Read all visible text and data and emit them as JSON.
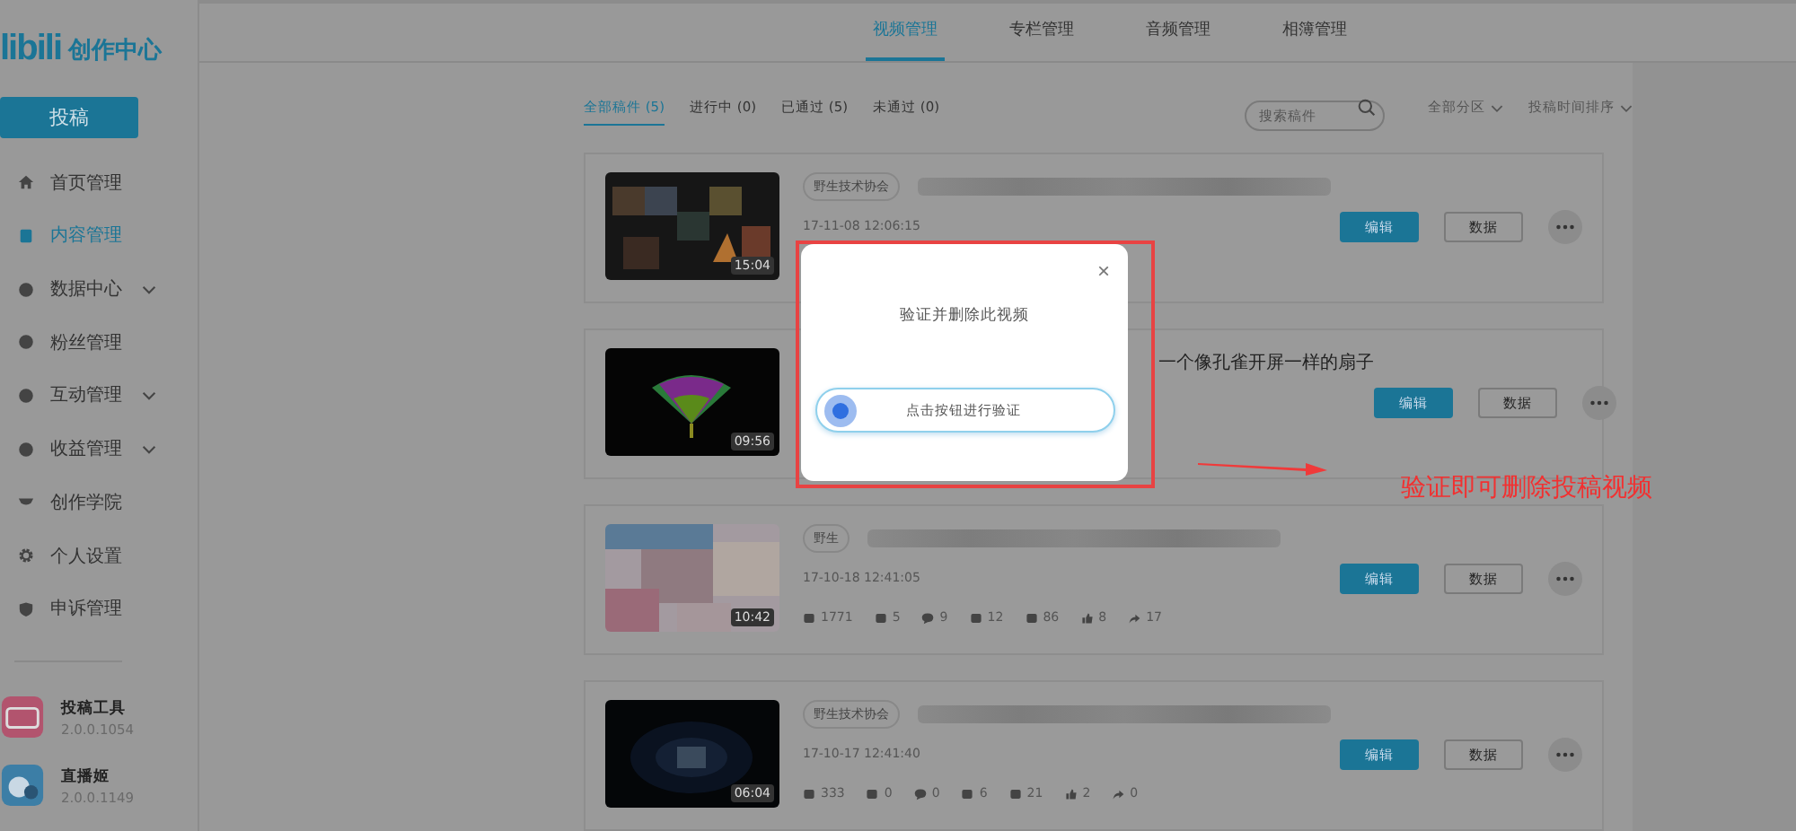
{
  "sidebar": {
    "logo_mark": "libili",
    "logo_text": "创作中心",
    "upload_button": "投稿",
    "items": [
      {
        "label": "首页管理",
        "selected": false,
        "has_submenu": false
      },
      {
        "label": "内容管理",
        "selected": true,
        "has_submenu": false
      },
      {
        "label": "数据中心",
        "selected": false,
        "has_submenu": true
      },
      {
        "label": "粉丝管理",
        "selected": false,
        "has_submenu": false
      },
      {
        "label": "互动管理",
        "selected": false,
        "has_submenu": true
      },
      {
        "label": "收益管理",
        "selected": false,
        "has_submenu": true
      },
      {
        "label": "创作学院",
        "selected": false,
        "has_submenu": false
      },
      {
        "label": "个人设置",
        "selected": false,
        "has_submenu": false
      },
      {
        "label": "申诉管理",
        "selected": false,
        "has_submenu": false
      }
    ],
    "apps": [
      {
        "name": "投稿工具",
        "version": "2.0.0.1054",
        "kind": "upload"
      },
      {
        "name": "直播姬",
        "version": "2.0.0.1149",
        "kind": "live"
      }
    ]
  },
  "top_tabs": [
    {
      "label": "视频管理",
      "selected": true
    },
    {
      "label": "专栏管理",
      "selected": false
    },
    {
      "label": "音频管理",
      "selected": false
    },
    {
      "label": "相簿管理",
      "selected": false
    }
  ],
  "filters": [
    {
      "label": "全部稿件 (5)",
      "selected": true
    },
    {
      "label": "进行中 (0)",
      "selected": false
    },
    {
      "label": "已通过 (5)",
      "selected": false
    },
    {
      "label": "未通过 (0)",
      "selected": false
    }
  ],
  "search": {
    "placeholder": "搜索稿件"
  },
  "sort": [
    "全部分区",
    "投稿时间排序"
  ],
  "videos": [
    {
      "kind": "mosaic",
      "duration": "15:04",
      "tag": "野生技术协会",
      "date": "17-11-08 12:06:15",
      "edit": "编辑",
      "data": "数据"
    },
    {
      "kind": "fan",
      "duration": "09:56",
      "title": "一个像孔雀开屏一样的扇子",
      "edit": "编辑",
      "data": "数据"
    },
    {
      "kind": "anime",
      "duration": "10:42",
      "tag": "野生",
      "date": "17-10-18 12:41:05",
      "stats": [
        "1771",
        "5",
        "9",
        "12",
        "86",
        "8",
        "17"
      ],
      "edit": "编辑",
      "data": "数据"
    },
    {
      "kind": "space",
      "duration": "06:04",
      "tag": "野生技术协会",
      "date": "17-10-17 12:41:40",
      "stats": [
        "333",
        "0",
        "0",
        "6",
        "21",
        "2",
        "0"
      ],
      "edit": "编辑",
      "data": "数据"
    }
  ],
  "dialog": {
    "title": "验证并删除此视频",
    "close": "×",
    "verify_button": "点击按钮进行验证"
  },
  "annotation": {
    "text": "验证即可删除投稿视频"
  }
}
